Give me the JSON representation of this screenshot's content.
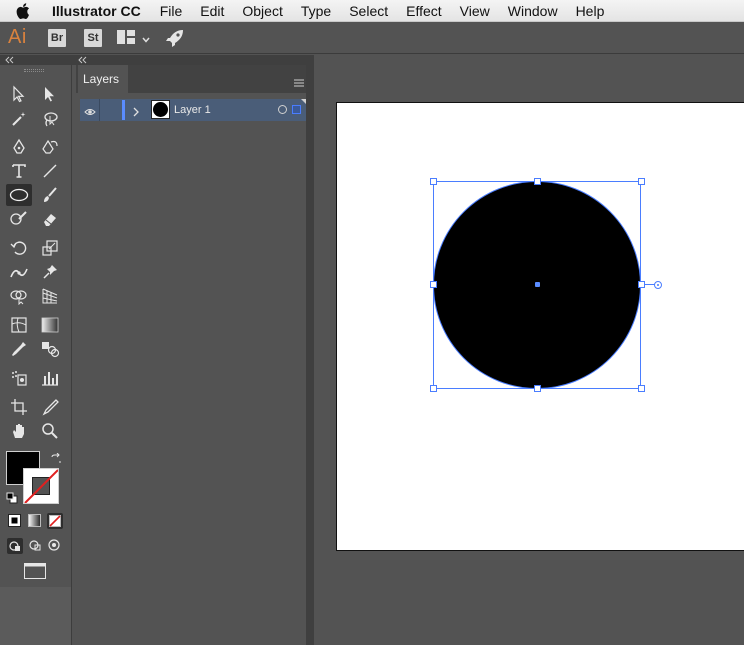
{
  "menubar": {
    "app_name": "Illustrator CC",
    "items": [
      "File",
      "Edit",
      "Object",
      "Type",
      "Select",
      "Effect",
      "View",
      "Window",
      "Help"
    ]
  },
  "appbar": {
    "logo": "Ai",
    "bridge_label": "Br",
    "stock_label": "St"
  },
  "layers_panel": {
    "tab_label": "Layers",
    "layers": [
      {
        "name": "Layer 1",
        "visible": true,
        "selected": true,
        "color": "#5a8cff"
      }
    ]
  },
  "tools": {
    "active": "ellipse-tool",
    "fill_color": "#000000",
    "stroke": "none"
  },
  "colors": {
    "selection_accent": "#4a7dff",
    "ai_brand": "#d9823e"
  }
}
